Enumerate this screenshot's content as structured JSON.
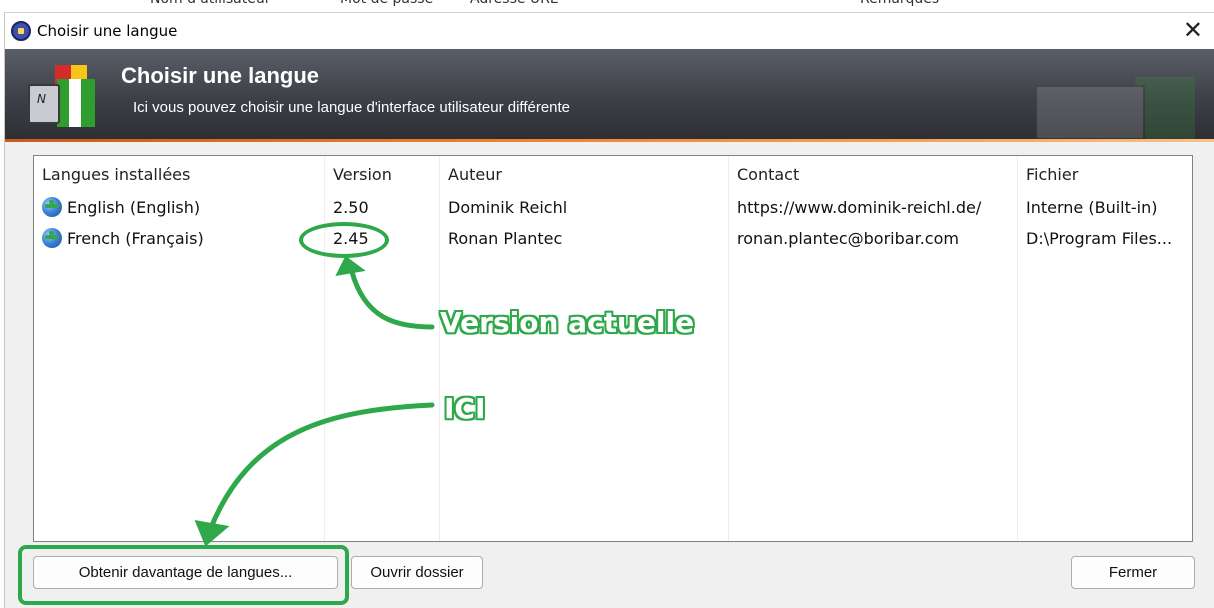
{
  "window": {
    "title": "Choisir une langue",
    "close_glyph": "✕"
  },
  "banner": {
    "title": "Choisir une langue",
    "subtitle": "Ici vous pouvez choisir une langue d'interface utilisateur différente"
  },
  "list": {
    "headers": [
      "Langues installées",
      "Version",
      "Auteur",
      "Contact",
      "Fichier"
    ],
    "rows": [
      [
        "English (English)",
        "2.50",
        "Dominik Reichl",
        "https://www.dominik-reichl.de/",
        "Interne (Built-in)"
      ],
      [
        "French (Français)",
        "2.45",
        "Ronan Plantec",
        "ronan.plantec@boribar.com",
        "D:\\Program Files..."
      ]
    ]
  },
  "buttons": {
    "get_more": "Obtenir davantage de langues...",
    "open_folder": "Ouvrir dossier",
    "close": "Fermer"
  },
  "annotations": {
    "version_label": "Version actuelle",
    "here_label": "ICI",
    "color": "#2ea84a"
  }
}
